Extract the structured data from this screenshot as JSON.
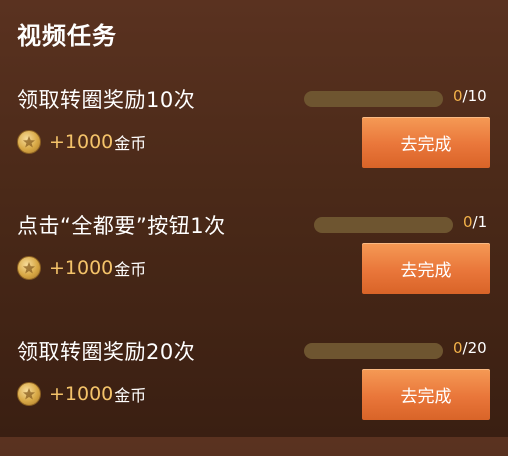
{
  "header": {
    "title": "视频任务"
  },
  "tasks": [
    {
      "name": "领取转圈奖励10次",
      "progress_current": "0",
      "progress_total": "/10",
      "progress_fraction": 0,
      "reward_amount": "+1000",
      "reward_unit": "金币",
      "button_label": "去完成"
    },
    {
      "name": "点击“全都要”按钮1次",
      "progress_current": "0",
      "progress_total": "/1",
      "progress_fraction": 0,
      "reward_amount": "+1000",
      "reward_unit": "金币",
      "button_label": "去完成"
    },
    {
      "name": "领取转圈奖励20次",
      "progress_current": "0",
      "progress_total": "/20",
      "progress_fraction": 0,
      "reward_amount": "+1000",
      "reward_unit": "金币",
      "button_label": "去完成"
    }
  ],
  "colors": {
    "accent_orange": "#e9763a",
    "coin_gold": "#d8a845",
    "progress_track": "#6e5530",
    "reward_text": "#f4c36a"
  },
  "icons": {
    "reward": "coin-icon"
  }
}
